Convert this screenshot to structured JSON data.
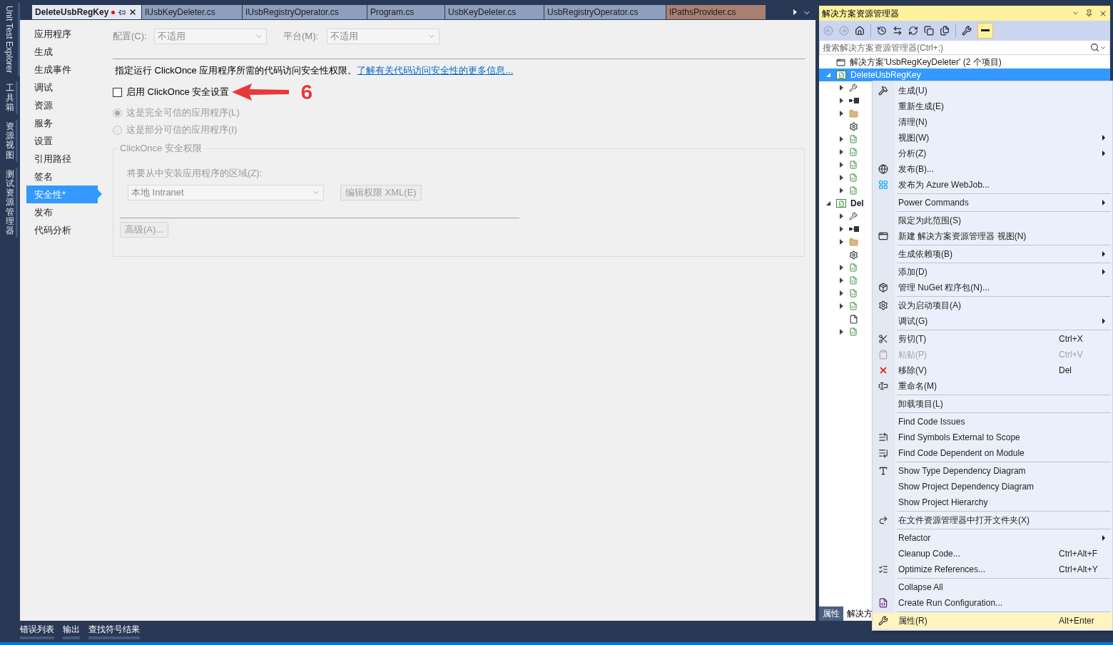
{
  "side_tabs": [
    {
      "label": "Unit Test Explorer",
      "kind": "rotated"
    },
    {
      "label": "工具箱",
      "kind": "stacked"
    },
    {
      "label": "资源视图",
      "kind": "stacked"
    },
    {
      "label": "测试资源管理器",
      "kind": "stacked"
    }
  ],
  "doc_tabs": [
    {
      "label": "DeleteUsbRegKey",
      "selected": true,
      "modified": true,
      "color": "#e3e8f4"
    },
    {
      "label": "IUsbKeyDeleter.cs",
      "selected": false,
      "modified": false,
      "color": "#8e9fbe"
    },
    {
      "label": "IUsbRegistryOperator.cs",
      "selected": false,
      "modified": false,
      "color": "#8e9fbe"
    },
    {
      "label": "Program.cs",
      "selected": false,
      "modified": false,
      "color": "#8e9fbe"
    },
    {
      "label": "UsbKeyDeleter.cs",
      "selected": false,
      "modified": false,
      "color": "#8e9fbe"
    },
    {
      "label": "UsbRegistryOperator.cs",
      "selected": false,
      "modified": false,
      "color": "#8e9fbe"
    },
    {
      "label": "IPathsProvider.cs",
      "selected": false,
      "modified": false,
      "color": "#a98072"
    }
  ],
  "settings_nav": [
    {
      "label": "应用程序",
      "selected": false
    },
    {
      "label": "生成",
      "selected": false
    },
    {
      "label": "生成事件",
      "selected": false
    },
    {
      "label": "调试",
      "selected": false
    },
    {
      "label": "资源",
      "selected": false
    },
    {
      "label": "服务",
      "selected": false
    },
    {
      "label": "设置",
      "selected": false
    },
    {
      "label": "引用路径",
      "selected": false
    },
    {
      "label": "签名",
      "selected": false
    },
    {
      "label": "安全性*",
      "selected": true
    },
    {
      "label": "发布",
      "selected": false
    },
    {
      "label": "代码分析",
      "selected": false
    }
  ],
  "security": {
    "configuration": {
      "label": "配置(C):",
      "value": "不适用",
      "disabled": true
    },
    "platform": {
      "label": "平台(M):",
      "value": "不适用",
      "disabled": true
    },
    "description": "指定运行 ClickOnce 应用程序所需的代码访问安全性权限。",
    "link": "了解有关代码访问安全性的更多信息...",
    "enable_checkbox": {
      "label": "启用 ClickOnce 安全设置",
      "checked": false
    },
    "annotation": "6",
    "trust_options": [
      {
        "label": "这是完全可信的应用程序(L)",
        "selected": true,
        "disabled": true
      },
      {
        "label": "这是部分可信的应用程序(I)",
        "selected": false,
        "disabled": true
      }
    ],
    "permissions_group": {
      "title": "ClickOnce 安全权限",
      "disabled": true,
      "zone_label": "将要从中安装应用程序的区域(Z):",
      "zone_value": "本地 Intranet",
      "edit_button": "编辑权限 XML(E)",
      "advanced_button": "高级(A)..."
    }
  },
  "solution_explorer": {
    "title": "解决方案资源管理器",
    "preview_on": true,
    "search_placeholder": "搜索解决方案资源管理器(Ctrl+;)",
    "tree": [
      {
        "label": "解决方案'UsbRegKeyDeleter' (2 个项目)",
        "kind": "solution",
        "selected": false,
        "children": [
          {
            "label": "DeleteUsbRegKey",
            "kind": "project",
            "expanded": true,
            "selected": true,
            "children": [
              {
                "kind": "properties",
                "expanded": false,
                "selected": false
              },
              {
                "kind": "references",
                "expanded": false,
                "selected": false
              },
              {
                "kind": "folder",
                "expanded": false,
                "selected": false
              },
              {
                "kind": "config",
                "selected": false
              },
              {
                "kind": "csharp",
                "expanded": false,
                "selected": false
              },
              {
                "kind": "csharp",
                "expanded": false,
                "selected": false
              },
              {
                "kind": "csharp",
                "expanded": false,
                "selected": false
              },
              {
                "kind": "csharp",
                "expanded": false,
                "selected": false
              },
              {
                "kind": "csharp",
                "expanded": false,
                "selected": false
              }
            ]
          },
          {
            "label": "Del",
            "kind": "project",
            "expanded": true,
            "selected": false,
            "children": [
              {
                "kind": "properties",
                "expanded": false,
                "selected": false
              },
              {
                "kind": "references",
                "expanded": false,
                "selected": false
              },
              {
                "kind": "folder",
                "expanded": false,
                "selected": false
              },
              {
                "kind": "config",
                "selected": false
              },
              {
                "kind": "csharp",
                "expanded": false,
                "selected": false
              },
              {
                "kind": "csharp",
                "expanded": false,
                "selected": false
              },
              {
                "kind": "csharp",
                "expanded": false,
                "selected": false
              },
              {
                "kind": "csharp",
                "expanded": false,
                "selected": false
              },
              {
                "kind": "file",
                "selected": false
              },
              {
                "kind": "csharp",
                "expanded": false,
                "selected": false
              }
            ]
          }
        ]
      }
    ],
    "panel_tabs": [
      {
        "label": "属性",
        "selected": false
      },
      {
        "label": "解决方",
        "selected": true
      }
    ]
  },
  "context_menu": [
    {
      "kind": "item",
      "label": "生成(U)",
      "submenu": false,
      "disabled": false,
      "selected": false
    },
    {
      "kind": "item",
      "label": "重新生成(E)",
      "submenu": false,
      "disabled": false,
      "selected": false
    },
    {
      "kind": "item",
      "label": "清理(N)",
      "submenu": false,
      "disabled": false,
      "selected": false
    },
    {
      "kind": "item",
      "label": "视图(W)",
      "submenu": true,
      "disabled": false,
      "selected": false
    },
    {
      "kind": "item",
      "label": "分析(Z)",
      "submenu": true,
      "disabled": false,
      "selected": false
    },
    {
      "kind": "item",
      "label": "发布(B)...",
      "submenu": false,
      "disabled": false,
      "selected": false
    },
    {
      "kind": "item",
      "label": "发布为 Azure WebJob...",
      "submenu": false,
      "disabled": false,
      "selected": false
    },
    {
      "kind": "separator"
    },
    {
      "kind": "item",
      "label": "Power Commands",
      "submenu": true,
      "disabled": false,
      "selected": false
    },
    {
      "kind": "separator"
    },
    {
      "kind": "item",
      "label": "限定为此范围(S)",
      "submenu": false,
      "disabled": false,
      "selected": false
    },
    {
      "kind": "item",
      "label": "新建 解决方案资源管理器 视图(N)",
      "submenu": false,
      "disabled": false,
      "selected": false
    },
    {
      "kind": "separator"
    },
    {
      "kind": "item",
      "label": "生成依赖项(B)",
      "submenu": true,
      "disabled": false,
      "selected": false
    },
    {
      "kind": "separator"
    },
    {
      "kind": "item",
      "label": "添加(D)",
      "submenu": true,
      "disabled": false,
      "selected": false
    },
    {
      "kind": "item",
      "label": "管理 NuGet 程序包(N)...",
      "submenu": false,
      "disabled": false,
      "selected": false
    },
    {
      "kind": "separator"
    },
    {
      "kind": "item",
      "label": "设为启动项目(A)",
      "submenu": false,
      "disabled": false,
      "selected": false
    },
    {
      "kind": "item",
      "label": "调试(G)",
      "submenu": true,
      "disabled": false,
      "selected": false
    },
    {
      "kind": "separator"
    },
    {
      "kind": "item",
      "label": "剪切(T)",
      "shortcut": "Ctrl+X",
      "submenu": false,
      "disabled": false,
      "selected": false
    },
    {
      "kind": "item",
      "label": "粘贴(P)",
      "shortcut": "Ctrl+V",
      "submenu": false,
      "disabled": true,
      "selected": false
    },
    {
      "kind": "item",
      "label": "移除(V)",
      "shortcut": "Del",
      "submenu": false,
      "disabled": false,
      "selected": false
    },
    {
      "kind": "item",
      "label": "重命名(M)",
      "submenu": false,
      "disabled": false,
      "selected": false
    },
    {
      "kind": "separator"
    },
    {
      "kind": "item",
      "label": "卸载项目(L)",
      "submenu": false,
      "disabled": false,
      "selected": false
    },
    {
      "kind": "separator"
    },
    {
      "kind": "item",
      "label": "Find Code Issues",
      "submenu": false,
      "disabled": false,
      "selected": false
    },
    {
      "kind": "item",
      "label": "Find Symbols External to Scope",
      "submenu": false,
      "disabled": false,
      "selected": false
    },
    {
      "kind": "item",
      "label": "Find Code Dependent on Module",
      "submenu": false,
      "disabled": false,
      "selected": false
    },
    {
      "kind": "separator"
    },
    {
      "kind": "item",
      "label": "Show Type Dependency Diagram",
      "submenu": false,
      "disabled": false,
      "selected": false
    },
    {
      "kind": "item",
      "label": "Show Project Dependency Diagram",
      "submenu": false,
      "disabled": false,
      "selected": false
    },
    {
      "kind": "item",
      "label": "Show Project Hierarchy",
      "submenu": false,
      "disabled": false,
      "selected": false
    },
    {
      "kind": "separator"
    },
    {
      "kind": "item",
      "label": "在文件资源管理器中打开文件夹(X)",
      "submenu": false,
      "disabled": false,
      "selected": false
    },
    {
      "kind": "separator"
    },
    {
      "kind": "item",
      "label": "Refactor",
      "submenu": true,
      "disabled": false,
      "selected": false
    },
    {
      "kind": "item",
      "label": "Cleanup Code...",
      "shortcut": "Ctrl+Alt+F",
      "submenu": false,
      "disabled": false,
      "selected": false
    },
    {
      "kind": "item",
      "label": "Optimize References...",
      "shortcut": "Ctrl+Alt+Y",
      "submenu": false,
      "disabled": false,
      "selected": false
    },
    {
      "kind": "separator"
    },
    {
      "kind": "item",
      "label": "Collapse All",
      "submenu": false,
      "disabled": false,
      "selected": false
    },
    {
      "kind": "item",
      "label": "Create Run Configuration...",
      "submenu": false,
      "disabled": false,
      "selected": false
    },
    {
      "kind": "separator"
    },
    {
      "kind": "item",
      "label": "属性(R)",
      "shortcut": "Alt+Enter",
      "submenu": false,
      "disabled": false,
      "selected": true
    }
  ],
  "tool_tabs": [
    {
      "label": "错误列表"
    },
    {
      "label": "输出"
    },
    {
      "label": "查找符号结果"
    }
  ]
}
